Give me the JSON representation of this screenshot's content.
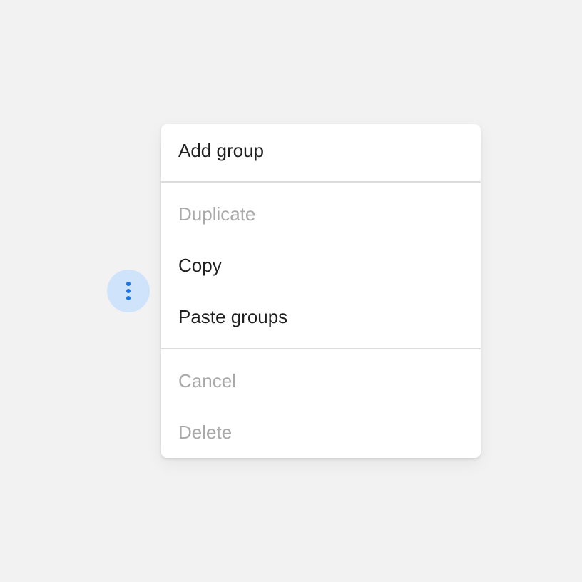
{
  "trigger": {
    "icon": "more-vert-icon",
    "accent_color": "#1a73e8",
    "background_color": "#cfe3fb"
  },
  "menu": {
    "sections": [
      {
        "items": [
          {
            "label": "Add group",
            "enabled": true
          }
        ]
      },
      {
        "items": [
          {
            "label": "Duplicate",
            "enabled": false
          },
          {
            "label": "Copy",
            "enabled": true
          },
          {
            "label": "Paste groups",
            "enabled": true
          }
        ]
      },
      {
        "items": [
          {
            "label": "Cancel",
            "enabled": false
          },
          {
            "label": "Delete",
            "enabled": false
          }
        ]
      }
    ],
    "enabled_text_color": "#1f1f1f",
    "disabled_text_color": "#a9a9a9"
  }
}
